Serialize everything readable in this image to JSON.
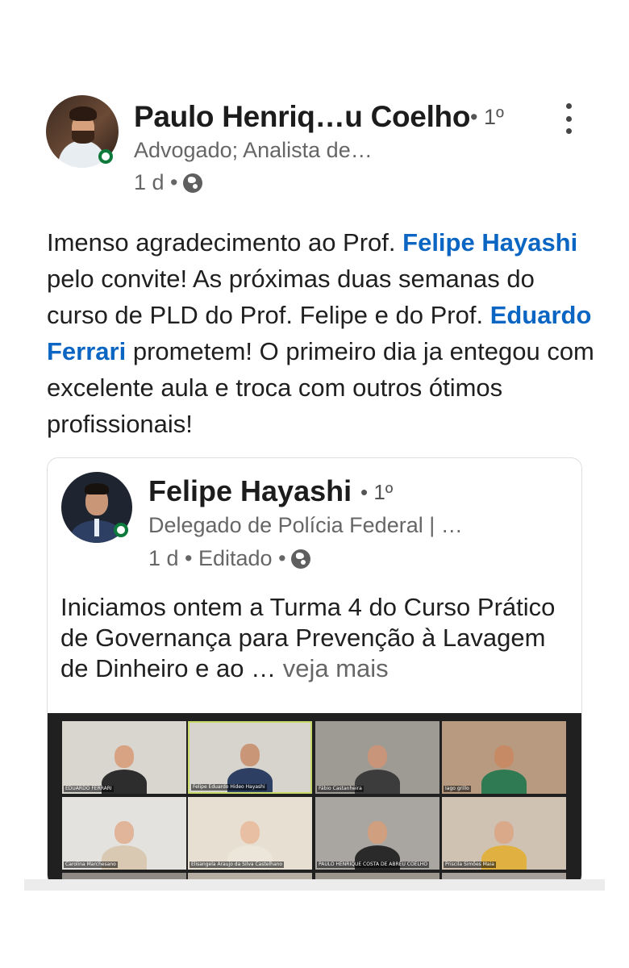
{
  "post": {
    "author_name": "Paulo Henriq…u Coelho",
    "author_degree": "• 1º",
    "author_headline": "Advogado; Analista de…",
    "post_time": "1 d •",
    "text_part1": "Imenso agradecimento ao Prof. ",
    "mention1": "Felipe Hayashi",
    "text_part2": " pelo convite! As próximas duas semanas do curso de PLD do Prof. Felipe e do Prof. ",
    "mention2": "Eduardo Ferrari",
    "text_part3": " prometem! O primeiro dia ja entegou com excelente aula e troca com outros ótimos profissionais!"
  },
  "shared": {
    "author_name": "Felipe Hayashi",
    "author_degree": "• 1º",
    "author_headline": "Delegado de Polícia Federal | …",
    "post_meta": "1 d • Editado •",
    "text": "Iniciamos ontem a Turma 4 do Curso Prático de Governança para Prevenção à Lavagem de Dinheiro e ao … ",
    "see_more": "veja mais"
  },
  "video_tiles": [
    {
      "caption": "EDUARDO FERRARI",
      "bg": "#d9d6d0",
      "skin": "#d8a382",
      "clothes": "#2d2d2d"
    },
    {
      "caption": "Felipe Eduardo Hideo Hayashi",
      "bg": "#d7d4ce",
      "skin": "#c99778",
      "clothes": "#2d3f63"
    },
    {
      "caption": "Fábio Castanheira",
      "bg": "#9e9a94",
      "skin": "#c8947a",
      "clothes": "#3c3c3c"
    },
    {
      "caption": "Iago grillo",
      "bg": "#b89a80",
      "skin": "#c68a64",
      "clothes": "#2f7a52"
    },
    {
      "caption": "Carolina Marchesano",
      "bg": "#e4e2de",
      "skin": "#e0b59a",
      "clothes": "#d9c8b2"
    },
    {
      "caption": "Elisangela Araujo da Silva Castelhano",
      "bg": "#e7dfd2",
      "skin": "#e8bfa2",
      "clothes": "#ece6da"
    },
    {
      "caption": "PAULO HENRIQUE COSTA DE ABREU COELHO",
      "bg": "#a9a6a2",
      "skin": "#cf9f80",
      "clothes": "#2a2a2a"
    },
    {
      "caption": "Priscila Simões Maia",
      "bg": "#cfc2b3",
      "skin": "#d9a98a",
      "clothes": "#e0b040"
    }
  ],
  "colors": {
    "mention": "#0a66c2",
    "online": "#0d7a3c",
    "active_speaker": "#c9d96a"
  },
  "icons": {
    "more": "more-vertical-icon",
    "visibility": "globe-icon",
    "online": "online-status-icon"
  }
}
